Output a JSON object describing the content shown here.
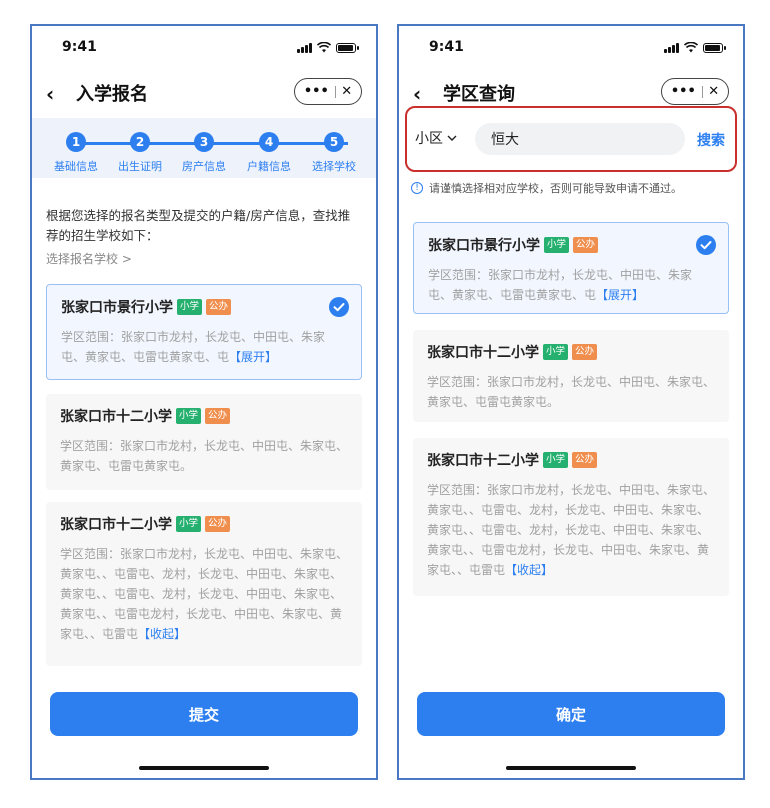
{
  "status": {
    "time": "9:41"
  },
  "left": {
    "title": "入学报名",
    "steps": [
      {
        "num": "1",
        "label": "基础信息"
      },
      {
        "num": "2",
        "label": "出生证明"
      },
      {
        "num": "3",
        "label": "房产信息"
      },
      {
        "num": "4",
        "label": "户籍信息"
      },
      {
        "num": "5",
        "label": "选择学校"
      }
    ],
    "intro": "根据您选择的报名类型及提交的户籍/房产信息，查找推荐的招生学校如下：",
    "choose": "选择报名学校 >",
    "cards": [
      {
        "name": "张家口市景行小学",
        "b1": "小学",
        "b2": "公办",
        "text": "学区范围：张家口市龙村，长龙屯、中田屯、朱家屯、黄家屯、屯雷屯黄家屯、屯",
        "link": "【展开】"
      },
      {
        "name": "张家口市十二小学",
        "b1": "小学",
        "b2": "公办",
        "text": "学区范围：张家口市龙村，长龙屯、中田屯、朱家屯、黄家屯、屯雷屯黄家屯。",
        "link": ""
      },
      {
        "name": "张家口市十二小学",
        "b1": "小学",
        "b2": "公办",
        "text": "学区范围：张家口市龙村，长龙屯、中田屯、朱家屯、黄家屯、、屯雷屯、龙村，长龙屯、中田屯、朱家屯、黄家屯、、屯雷屯、龙村，长龙屯、中田屯、朱家屯、黄家屯、、屯雷屯龙村，长龙屯、中田屯、朱家屯、黄家屯、、屯雷屯",
        "link": "【收起】"
      }
    ],
    "submit": "提交"
  },
  "right": {
    "title": "学区查询",
    "search_type": "小区",
    "search_value": "恒大",
    "search_btn": "搜索",
    "warning": "请谨慎选择相对应学校，否则可能导致申请不通过。",
    "cards": [
      {
        "name": "张家口市景行小学",
        "b1": "小学",
        "b2": "公办",
        "text": "学区范围：张家口市龙村，长龙屯、中田屯、朱家屯、黄家屯、屯雷屯黄家屯、屯",
        "link": "【展开】"
      },
      {
        "name": "张家口市十二小学",
        "b1": "小学",
        "b2": "公办",
        "text": "学区范围：张家口市龙村，长龙屯、中田屯、朱家屯、黄家屯、屯雷屯黄家屯。",
        "link": ""
      },
      {
        "name": "张家口市十二小学",
        "b1": "小学",
        "b2": "公办",
        "text": "学区范围：张家口市龙村，长龙屯、中田屯、朱家屯、黄家屯、、屯雷屯、龙村，长龙屯、中田屯、朱家屯、黄家屯、、屯雷屯、龙村，长龙屯、中田屯、朱家屯、黄家屯、、屯雷屯龙村，长龙屯、中田屯、朱家屯、黄家屯、、屯雷屯",
        "link": "【收起】"
      }
    ],
    "confirm": "确定"
  },
  "colors": {
    "primary": "#2d7ff0",
    "highlight_border": "#c9302c",
    "badge_green": "#25b06f",
    "badge_orange": "#ef8e4d"
  }
}
